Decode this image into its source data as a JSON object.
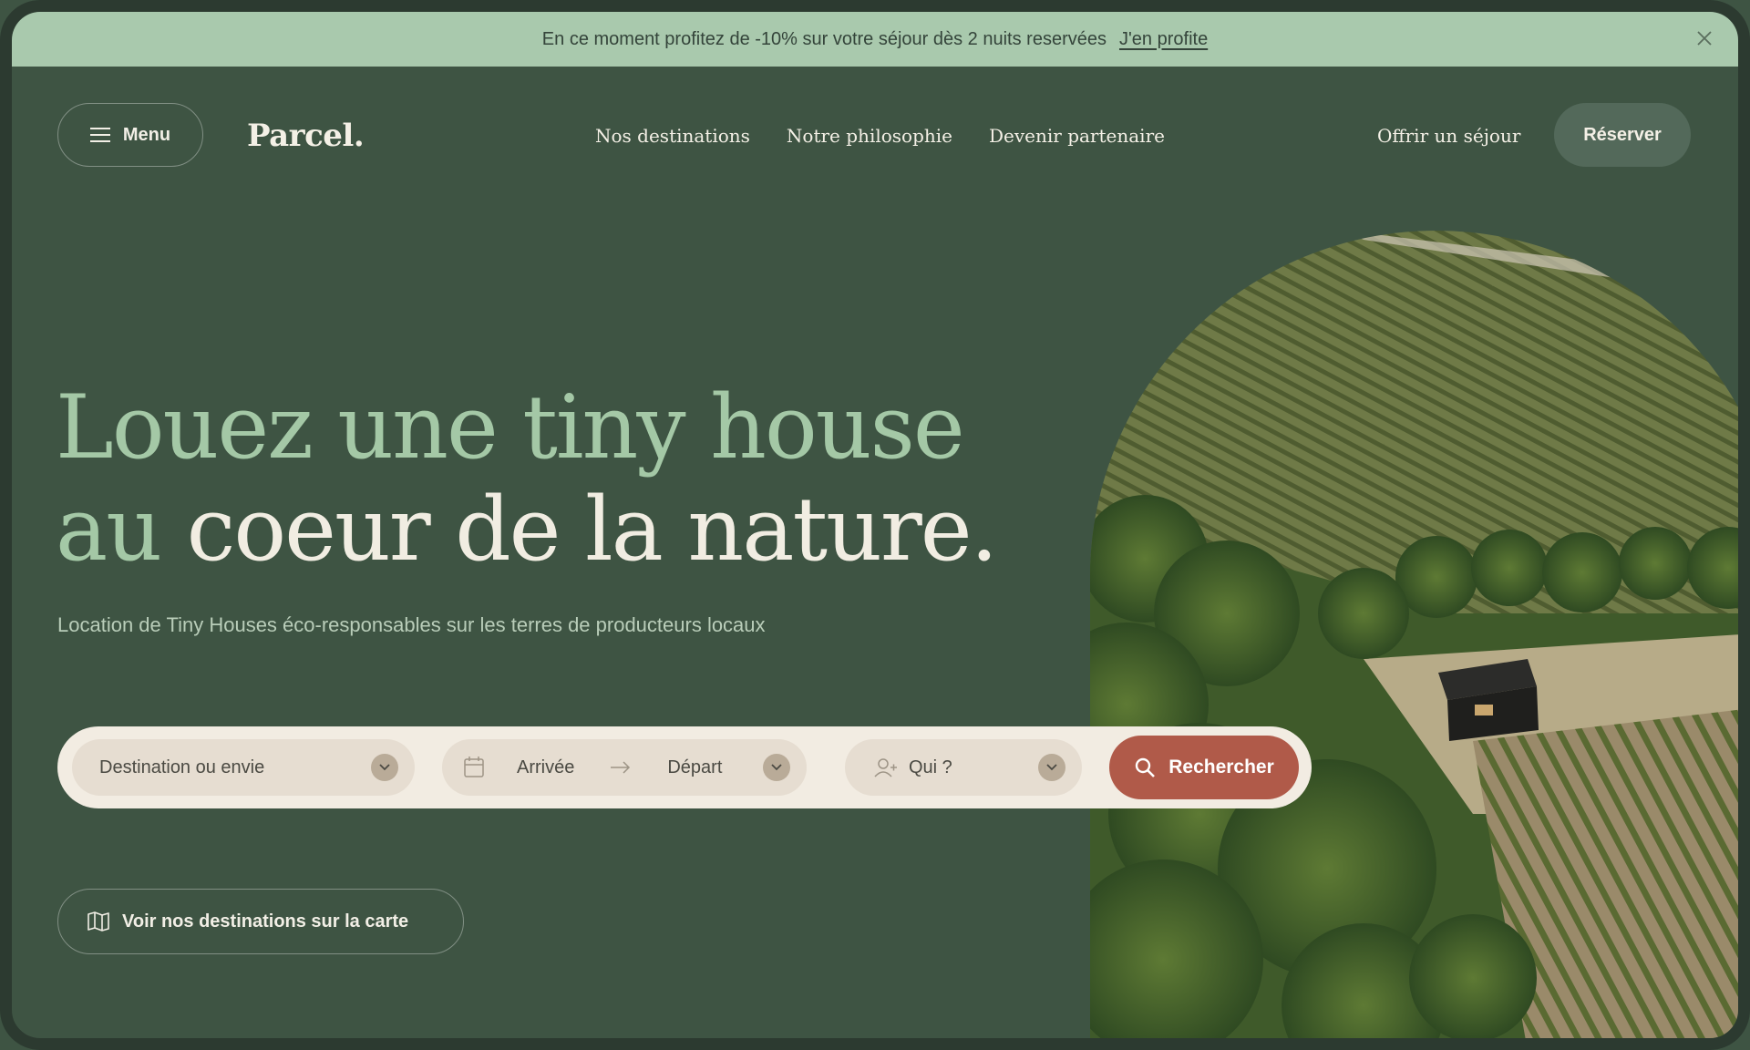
{
  "promo": {
    "text": "En ce moment profitez de -10% sur votre séjour dès 2 nuits reservées",
    "link": "J'en profite"
  },
  "header": {
    "menu_label": "Menu",
    "logo": "Parcel.",
    "nav": [
      "Nos destinations",
      "Notre philosophie",
      "Devenir partenaire"
    ],
    "offer": "Offrir un séjour",
    "reserve": "Réserver"
  },
  "hero": {
    "title_line1": "Louez une tiny house",
    "title_line2_green": "au",
    "title_line2_cream": " coeur de la nature.",
    "subtitle": "Location de Tiny Houses éco-responsables sur les terres de producteurs locaux"
  },
  "search": {
    "destination_placeholder": "Destination ou envie",
    "arrival": "Arrivée",
    "departure": "Départ",
    "who": "Qui ?",
    "button": "Rechercher"
  },
  "map_button": "Voir nos destinations sur la carte",
  "colors": {
    "background": "#3e5443",
    "promo_bg": "#a9c9ad",
    "accent_green": "#a4c8a6",
    "cream": "#f1ede2",
    "search_button": "#b05a49"
  }
}
